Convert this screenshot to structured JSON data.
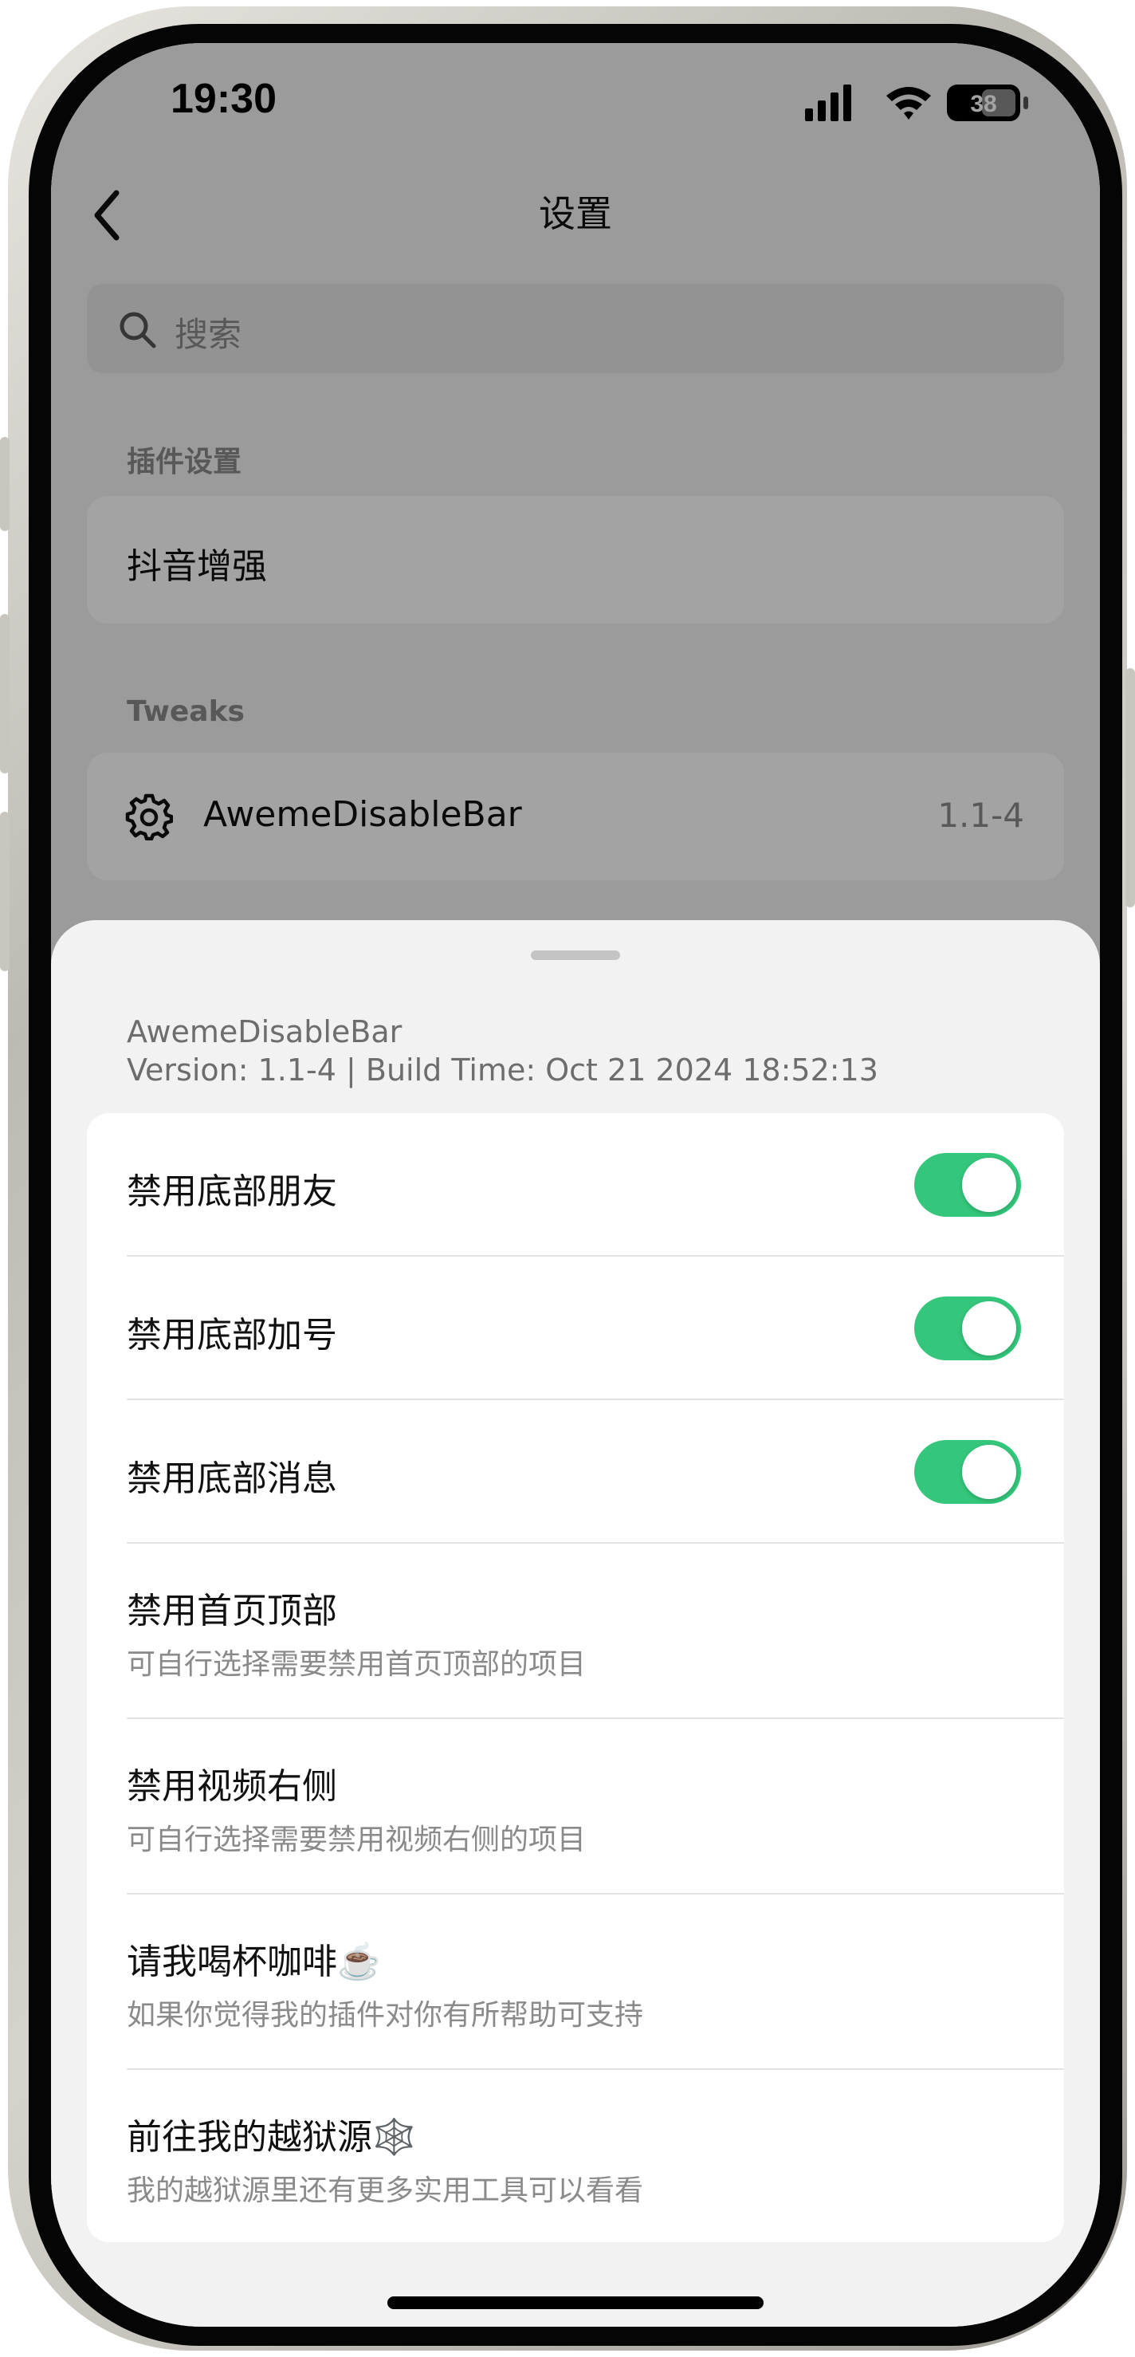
{
  "status": {
    "time": "19:30",
    "battery": "38"
  },
  "nav": {
    "title": "设置"
  },
  "search": {
    "placeholder": "搜索"
  },
  "sections": {
    "plugins": {
      "label": "插件设置",
      "item": "抖音增强"
    },
    "tweaks": {
      "label": "Tweaks",
      "item_name": "AwemeDisableBar",
      "item_version": "1.1-4"
    }
  },
  "sheet": {
    "name": "AwemeDisableBar",
    "version_line": "Version: 1.1-4 | Build Time: Oct 21 2024 18:52:13",
    "rows": [
      {
        "title": "禁用底部朋友",
        "toggle": true
      },
      {
        "title": "禁用底部加号",
        "toggle": true
      },
      {
        "title": "禁用底部消息",
        "toggle": true
      },
      {
        "title": "禁用首页顶部",
        "subtitle": "可自行选择需要禁用首页顶部的项目"
      },
      {
        "title": "禁用视频右侧",
        "subtitle": "可自行选择需要禁用视频右侧的项目"
      },
      {
        "title": "请我喝杯咖啡☕️",
        "subtitle": "如果你觉得我的插件对你有所帮助可支持"
      },
      {
        "title": "前往我的越狱源🕸️",
        "subtitle": "我的越狱源里还有更多实用工具可以看看"
      }
    ]
  },
  "colors": {
    "toggle_on": "#34c77b",
    "sheet_bg": "#f2f2f2",
    "card_bg": "#ffffff"
  },
  "icons": [
    "chevron-left-icon",
    "search-icon",
    "gear-icon",
    "signal-icon",
    "wifi-icon",
    "battery-icon"
  ]
}
